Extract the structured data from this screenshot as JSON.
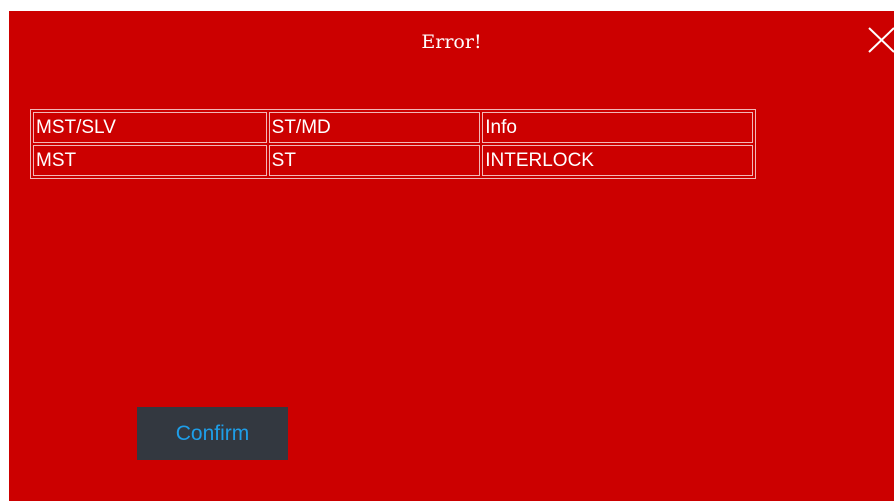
{
  "dialog": {
    "title": "Error!",
    "close_icon": "close-icon",
    "background_color": "#cc0000"
  },
  "table": {
    "headers": [
      "MST/SLV",
      "ST/MD",
      "Info"
    ],
    "rows": [
      [
        "MST",
        "ST",
        "INTERLOCK"
      ]
    ]
  },
  "actions": {
    "confirm_label": "Confirm",
    "confirm_bg": "#333840",
    "confirm_text_color": "#1e9ee8"
  }
}
